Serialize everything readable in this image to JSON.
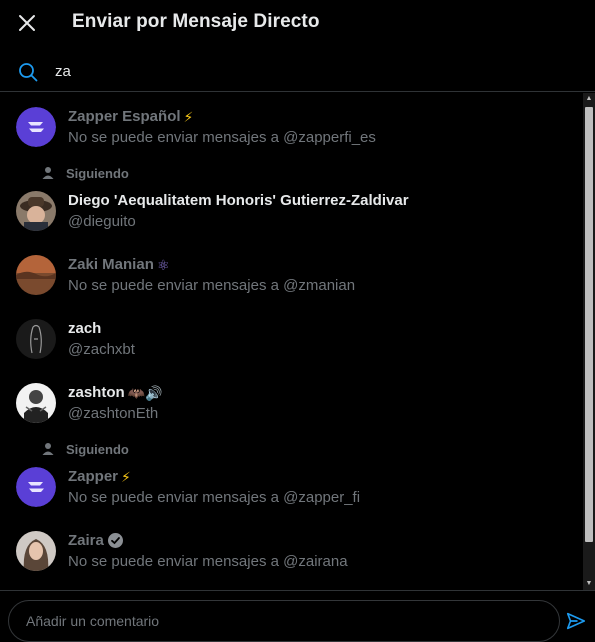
{
  "header": {
    "title": "Enviar por Mensaje Directo"
  },
  "search": {
    "value": "za"
  },
  "following_label": "Siguiendo",
  "users": [
    {
      "name": "Zapper Español",
      "badge": "⚡",
      "subtitle": "No se puede enviar mensajes a @zapperfi_es",
      "disabled": true,
      "following": false,
      "avatar": "zapper"
    },
    {
      "name": "Diego 'Aequalitatem Honoris' Gutierrez-Zaldivar",
      "badge": "",
      "subtitle": "@dieguito",
      "disabled": false,
      "following": true,
      "avatar": "photo-cowboy"
    },
    {
      "name": "Zaki Manian",
      "badge": "⚛",
      "subtitle": "No se puede enviar mensajes a @zmanian",
      "disabled": true,
      "following": false,
      "avatar": "photo-landscape"
    },
    {
      "name": "zach",
      "badge": "",
      "subtitle": "@zachxbt",
      "disabled": false,
      "following": false,
      "avatar": "sketch"
    },
    {
      "name": "zashton",
      "badge": "🦇🔊",
      "subtitle": "@zashtonEth",
      "disabled": false,
      "following": false,
      "avatar": "photo-bw"
    },
    {
      "name": "Zapper",
      "badge": "⚡",
      "subtitle": "No se puede enviar mensajes a @zapper_fi",
      "disabled": true,
      "following": true,
      "avatar": "zapper"
    },
    {
      "name": "Zaira",
      "badge": "✔",
      "subtitle": "No se puede enviar mensajes a @zairana",
      "disabled": true,
      "following": false,
      "avatar": "photo-woman"
    }
  ],
  "footer": {
    "placeholder": "Añadir un comentario"
  },
  "colors": {
    "accent": "#1d9bf0",
    "zapper_purple": "#5a3fd6",
    "muted": "#71767b",
    "text": "#e7e9ea",
    "border": "#2f3336"
  },
  "icons": {
    "close": "close-icon",
    "search": "search-icon",
    "person": "person-icon",
    "send": "send-icon",
    "verified": "verified-icon"
  }
}
